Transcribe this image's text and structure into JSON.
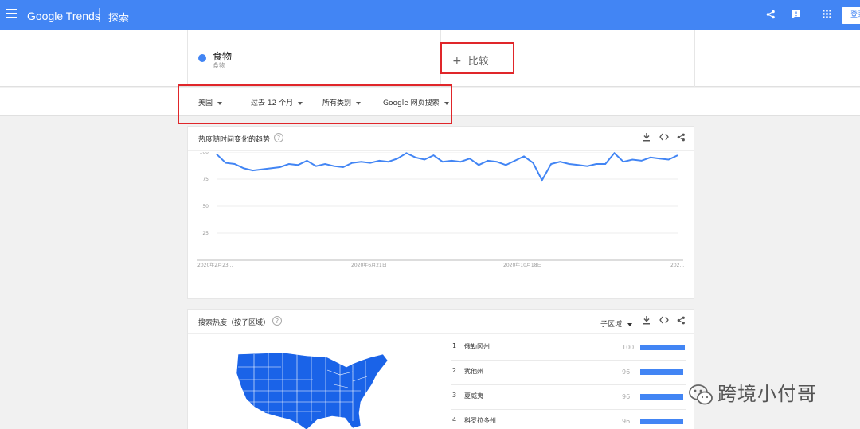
{
  "header": {
    "logo": "Google Trends",
    "section": "探索",
    "login_label": "登录"
  },
  "term": {
    "name": "食物",
    "subtitle": "食物",
    "color": "#4285f4"
  },
  "compare": {
    "plus": "+",
    "label": "比较"
  },
  "filters": [
    {
      "label": "美国"
    },
    {
      "label": "过去 12 个月"
    },
    {
      "label": "所有类别"
    },
    {
      "label": "Google 网页搜索"
    }
  ],
  "interest_over_time": {
    "title": "热度随时间变化的趋势",
    "help": "?",
    "chart_data": {
      "type": "line",
      "title": "",
      "xlabel": "",
      "ylabel": "",
      "ylim": [
        0,
        100
      ],
      "yticks": [
        100,
        75,
        50,
        25
      ],
      "x_labels": [
        "2020年2月23...",
        "2020年6月21日",
        "2020年10月18日",
        "202..."
      ],
      "series": [
        {
          "values": [
            98,
            90,
            89,
            85,
            83,
            84,
            85,
            86,
            89,
            88,
            92,
            87,
            89,
            87,
            86,
            90,
            91,
            90,
            92,
            91,
            94,
            99,
            95,
            93,
            97,
            91,
            92,
            91,
            94,
            88,
            92,
            91,
            88,
            92,
            96,
            90,
            74,
            89,
            91,
            89,
            88,
            87,
            89,
            89,
            99,
            91,
            93,
            92,
            95,
            94,
            93,
            97
          ],
          "color": "#4285f4"
        }
      ]
    }
  },
  "interest_by_region": {
    "title": "搜索热度（按子区域）",
    "help": "?",
    "dropdown": "子区域",
    "rows": [
      {
        "rank": "1",
        "name": "俄勒冈州",
        "value": 100
      },
      {
        "rank": "2",
        "name": "犹他州",
        "value": 96
      },
      {
        "rank": "3",
        "name": "夏威夷",
        "value": 96
      },
      {
        "rank": "4",
        "name": "科罗拉多州",
        "value": 96
      }
    ]
  },
  "watermark": {
    "text": "跨境小付哥"
  },
  "icons": {
    "menu": "menu-icon",
    "share": "share-icon",
    "feedback": "feedback-icon",
    "apps": "apps-icon",
    "download": "download-icon",
    "embed": "embed-icon",
    "chevron": "chevron-down-icon"
  },
  "colors": {
    "header": "#4285f4",
    "highlight": "#e0262a",
    "line": "#4285f4"
  }
}
